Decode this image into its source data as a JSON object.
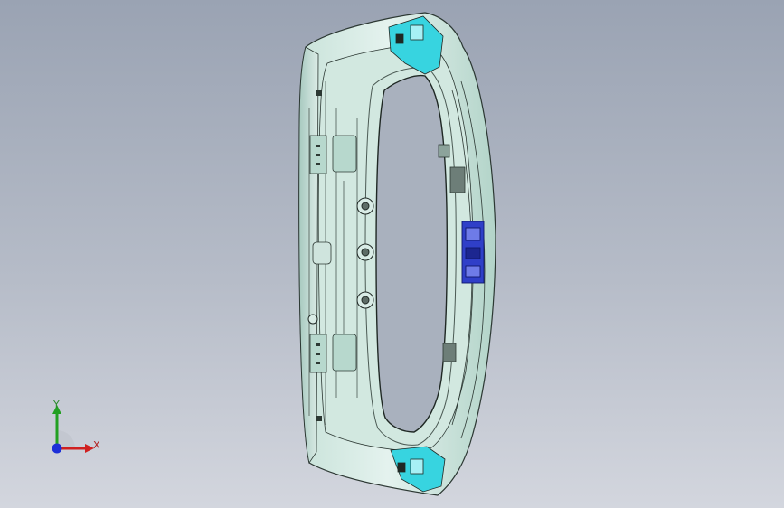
{
  "viewport": {
    "background_top": "#9aa3b3",
    "background_bottom": "#d3d6de"
  },
  "model": {
    "body_color": "#ddeee8",
    "shade_color": "#b7d8cd",
    "edge_color": "#2c3833",
    "highlight_cyan": "#37d4e0",
    "highlight_blue": "#2f3fc8"
  },
  "triad": {
    "x_label": "X",
    "y_label": "Y",
    "x_color": "#d02020",
    "y_color": "#22a022",
    "z_color": "#1c2fd8"
  }
}
